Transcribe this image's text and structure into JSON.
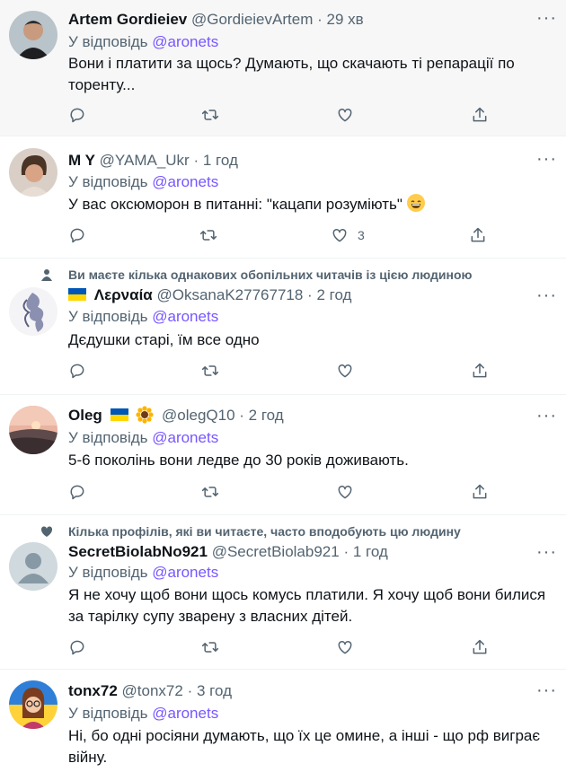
{
  "tweets": [
    {
      "name": "Artem Gordieiev",
      "handle": "@GordieievArtem",
      "time": "29 хв",
      "reply_prefix": "У відповідь",
      "reply_to": "@aronets",
      "text_lines": [
        "Вони і платити за щось? Думають, що скачають ті репарації по",
        "торенту..."
      ],
      "like_count": ""
    },
    {
      "name": "M Y",
      "handle": "@YAMA_Ukr",
      "time": "1 год",
      "reply_prefix": "У відповідь",
      "reply_to": "@aronets",
      "text_lines": [
        "У вас оксюморон в питанні: \"кацапи розуміють\""
      ],
      "like_count": "3"
    },
    {
      "social": "Ви маєте кілька однакових обопільних читачів із цією людиною",
      "name": "Λερναία",
      "handle": "@OksanaK27767718",
      "time": "2 год",
      "reply_prefix": "У відповідь",
      "reply_to": "@aronets",
      "text_lines": [
        "Дєдушки старі, їм все одно"
      ],
      "like_count": ""
    },
    {
      "name": "Oleg",
      "handle": "@olegQ10",
      "time": "2 год",
      "reply_prefix": "У відповідь",
      "reply_to": "@aronets",
      "text_lines": [
        "5-6 поколінь вони ледве до 30 років доживають."
      ],
      "like_count": ""
    },
    {
      "social": "Кілька профілів, які ви читаєте, часто вподобують цю людину",
      "name": "SecretBiolabNo921",
      "handle": "@SecretBiolab921",
      "time": "1 год",
      "reply_prefix": "У відповідь",
      "reply_to": "@aronets",
      "text_lines": [
        "Я не хочу щоб вони щось комусь платили. Я хочу щоб вони билися",
        "за тарілку супу зварену з власних дітей."
      ],
      "like_count": ""
    },
    {
      "name": "tonx72",
      "handle": "@tonx72",
      "time": "3 год",
      "reply_prefix": "У відповідь",
      "reply_to": "@aronets",
      "text_lines": [
        "Ні, бо одні росіяни думають, що їх це омине, а інші - що рф виграє",
        "війну."
      ],
      "like_count": ""
    }
  ],
  "icons": {
    "reply": "reply-icon",
    "retweet": "retweet-icon",
    "like": "heart-icon",
    "share": "share-icon",
    "more": "more-icon"
  },
  "more_glyph": "···",
  "colors": {
    "text": "#0f1419",
    "secondary": "#536471",
    "mention": "#7856ff",
    "highlight_bg": "#f7f7f7"
  }
}
